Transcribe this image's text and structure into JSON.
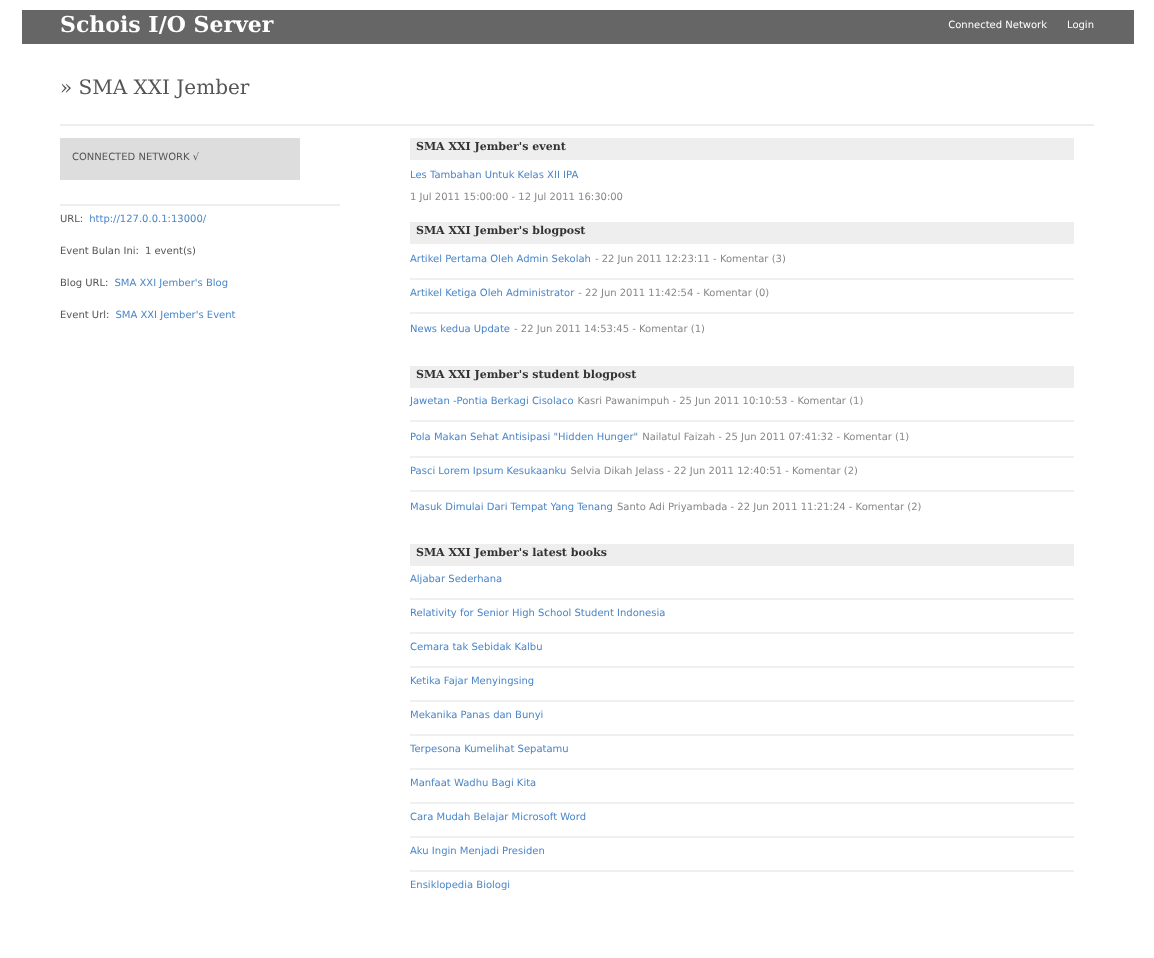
{
  "header": {
    "title": "Schois I/O Server",
    "nav": [
      "Connected Network",
      "Login"
    ]
  },
  "breadcrumb": "» SMA XXI Jember",
  "sidebar": {
    "status": "CONNECTED NETWORK √",
    "fields": [
      {
        "label": "URL:",
        "value": "http://127.0.0.1:13000/",
        "kind": "link"
      },
      {
        "label": "Event Bulan Ini:",
        "value": "1 event(s)",
        "kind": "text"
      },
      {
        "label": "Blog URL:",
        "value": "SMA XXI Jember's Blog",
        "kind": "link"
      },
      {
        "label": "Event Url:",
        "value": "SMA XXI Jember's Event",
        "kind": "link"
      }
    ]
  },
  "sections": [
    {
      "title": "SMA XXI Jember's event",
      "kind": "event",
      "items": [
        {
          "link": "Les Tambahan Untuk Kelas XII IPA",
          "meta": "1 Jul 2011 15:00:00 - 12 Jul 2011 16:30:00"
        }
      ]
    },
    {
      "title": "SMA XXI Jember's blogpost",
      "kind": "post",
      "items": [
        {
          "link": "Artikel Pertama Oleh Admin Sekolah",
          "meta": "- 22 Jun 2011 12:23:11 - Komentar (3)"
        },
        {
          "link": "Artikel Ketiga Oleh Administrator",
          "meta": "- 22 Jun 2011 11:42:54 - Komentar (0)"
        },
        {
          "link": "News kedua Update",
          "meta": "- 22 Jun 2011 14:53:45 - Komentar (1)"
        }
      ]
    },
    {
      "title": "SMA XXI Jember's student blogpost",
      "kind": "post",
      "items": [
        {
          "link": "Jawetan -Pontia Berkagi Cisolaco",
          "meta": "Kasri Pawanimpuh - 25 Jun 2011 10:10:53 - Komentar (1)"
        },
        {
          "link": "Pola Makan Sehat Antisipasi \"Hidden Hunger\"",
          "meta": "Nailatul Faizah - 25 Jun 2011 07:41:32 - Komentar (1)"
        },
        {
          "link": "Pasci Lorem Ipsum Kesukaanku",
          "meta": "Selvia Dikah Jelass - 22 Jun 2011 12:40:51 - Komentar (2)"
        },
        {
          "link": "Masuk Dimulai Dari Tempat Yang Tenang",
          "meta": "Santo Adi Priyambada - 22 Jun 2011 11:21:24 - Komentar (2)"
        }
      ]
    },
    {
      "title": "SMA XXI Jember's latest books",
      "kind": "books",
      "items": [
        {
          "link": "Aljabar Sederhana"
        },
        {
          "link": "Relativity for Senior High School Student Indonesia"
        },
        {
          "link": "Cemara tak Sebidak Kalbu"
        },
        {
          "link": "Ketika Fajar Menyingsing"
        },
        {
          "link": "Mekanika Panas dan Bunyi"
        },
        {
          "link": "Terpesona Kumelihat Sepatamu"
        },
        {
          "link": "Manfaat Wadhu Bagi Kita"
        },
        {
          "link": "Cara Mudah Belajar Microsoft Word"
        },
        {
          "link": "Aku Ingin Menjadi Presiden"
        },
        {
          "link": "Ensiklopedia Biologi"
        }
      ]
    }
  ]
}
